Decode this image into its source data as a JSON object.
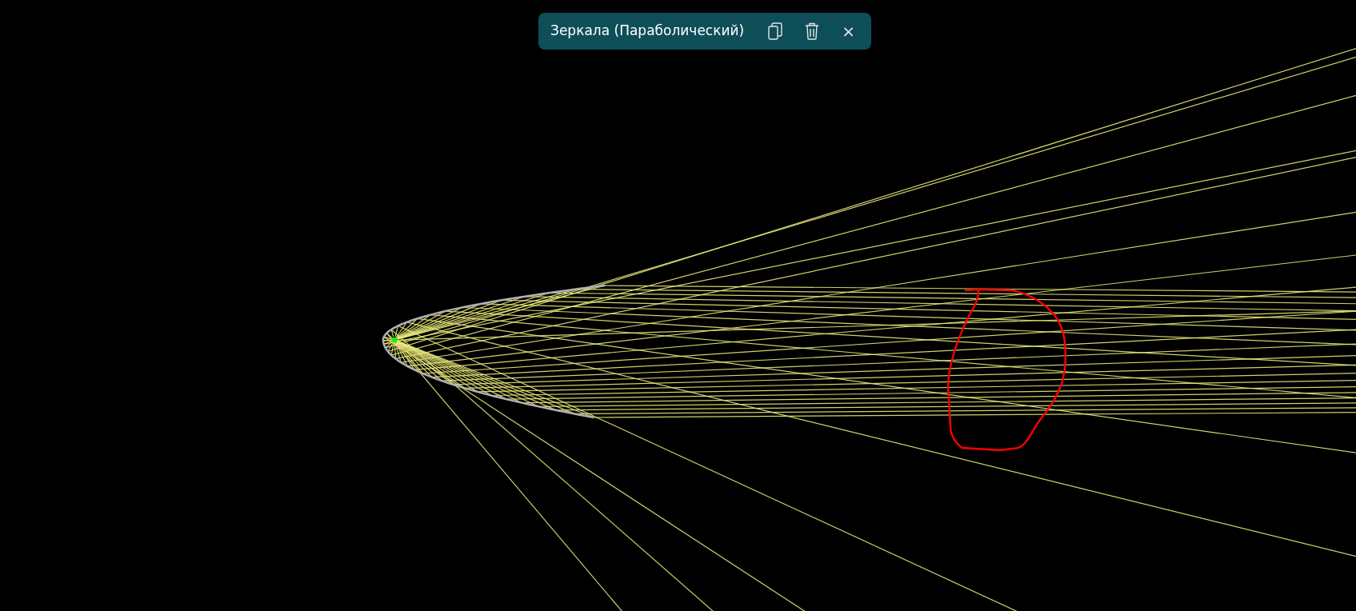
{
  "toolbar": {
    "title": "Зеркала (Параболический)",
    "buttons": [
      {
        "kind": "copy"
      },
      {
        "kind": "delete"
      }
    ],
    "close": "×"
  }
}
